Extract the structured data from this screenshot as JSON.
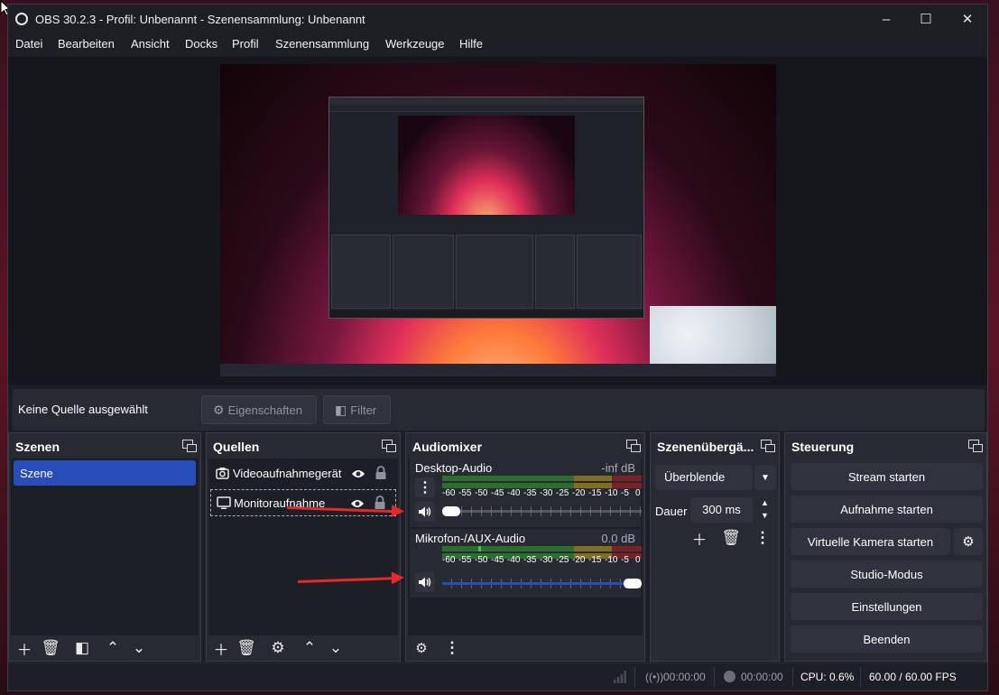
{
  "window": {
    "title": "OBS 30.2.3 - Profil: Unbenannt - Szenensammlung: Unbenannt",
    "controls": {
      "minimize": "–",
      "maximize": "☐",
      "close": "✕"
    }
  },
  "menu": [
    "Datei",
    "Bearbeiten",
    "Ansicht",
    "Docks",
    "Profil",
    "Szenensammlung",
    "Werkzeuge",
    "Hilfe"
  ],
  "source_toolbar": {
    "label": "Keine Quelle ausgewählt",
    "properties_label": "Eigenschaften",
    "filter_label": "Filter"
  },
  "scenes": {
    "title": "Szenen",
    "items": [
      "Szene"
    ],
    "toolbar_icons": [
      "add-icon",
      "trash-icon",
      "filter-icon",
      "chevron-up-icon",
      "chevron-down-icon"
    ]
  },
  "sources": {
    "title": "Quellen",
    "items": [
      {
        "name": "Videoaufnahmegerät",
        "icon": "camera-icon",
        "visible": true,
        "locked": true
      },
      {
        "name": "Monitoraufnahme",
        "icon": "monitor-icon",
        "visible": true,
        "locked": true
      }
    ]
  },
  "audiomixer": {
    "title": "Audiomixer",
    "scale": [
      "-60",
      "-55",
      "-50",
      "-45",
      "-40",
      "-35",
      "-30",
      "-25",
      "-20",
      "-15",
      "-10",
      "-5",
      "0"
    ],
    "channels": [
      {
        "name": "Desktop-Audio",
        "db": "-inf dB",
        "volume": 0.0,
        "level": 0.0
      },
      {
        "name": "Mikrofon-/AUX-Audio",
        "db": "0.0 dB",
        "volume": 1.0,
        "level": 0.18
      }
    ]
  },
  "transitions": {
    "title": "Szenenübergä...",
    "selected": "Überblende",
    "duration_label": "Dauer",
    "duration_value": "300 ms"
  },
  "controls": {
    "title": "Steuerung",
    "stream": "Stream starten",
    "record": "Aufnahme starten",
    "virtual_cam": "Virtuelle Kamera starten",
    "studio": "Studio-Modus",
    "settings": "Einstellungen",
    "exit": "Beenden"
  },
  "status": {
    "stream_time": "00:00:00",
    "record_time": "00:00:00",
    "cpu": "CPU: 0.6%",
    "fps": "60.00 / 60.00 FPS"
  },
  "colors": {
    "accent": "#284cb8",
    "panel": "#272a33",
    "background": "#1d1f26",
    "annotation_arrow": "#e22a2a"
  }
}
